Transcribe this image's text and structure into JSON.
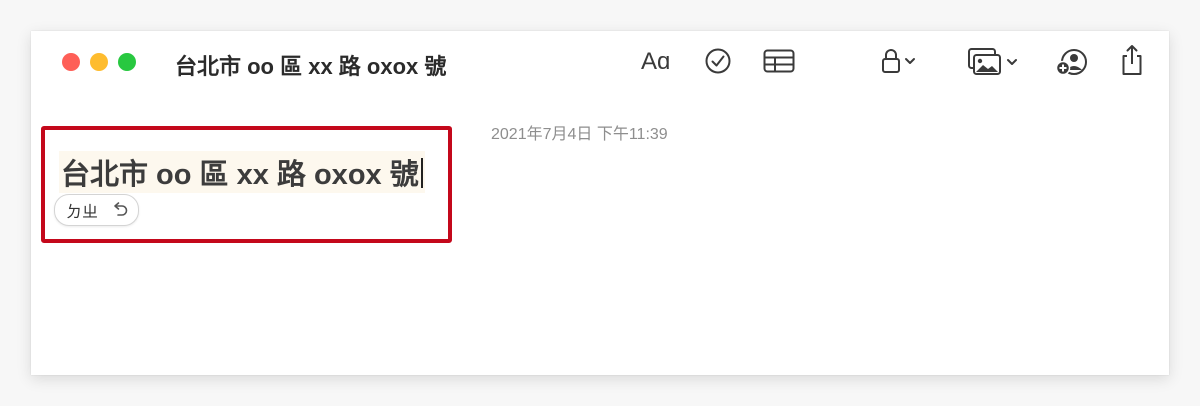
{
  "window": {
    "title": "台北市 oo 區 xx 路 oxox 號"
  },
  "toolbar": {
    "font_label": "Aɑ",
    "icons": [
      "checklist-icon",
      "table-icon",
      "lock-icon",
      "media-icon",
      "collaborate-icon",
      "share-icon"
    ]
  },
  "note": {
    "timestamp": "2021年7月4日 下午11:39",
    "text": "台北市 oo 區 xx 路 oxox 號",
    "ime_candidate": "ㄉㄓ"
  },
  "colors": {
    "highlight_border": "#c4081b",
    "close": "#fe5f57",
    "minimize": "#febc2e",
    "zoom": "#28c840"
  }
}
